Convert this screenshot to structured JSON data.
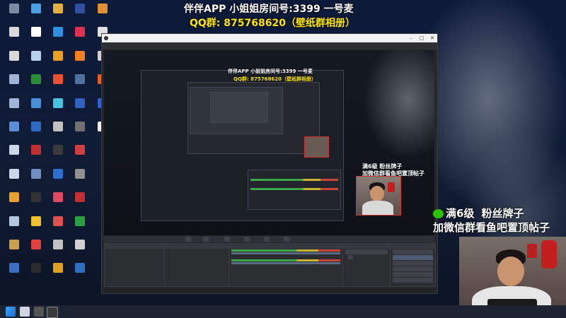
{
  "desktop": {
    "icons": [
      {
        "label": "",
        "color": "#7a8aa0"
      },
      {
        "label": "",
        "color": "#d9d9d9"
      },
      {
        "label": "",
        "color": "#d9d9d9"
      },
      {
        "label": "",
        "color": "#9fb4d8"
      },
      {
        "label": "",
        "color": "#9fb4d8"
      },
      {
        "label": "",
        "color": "#5a8fd8"
      },
      {
        "label": "",
        "color": "#c9d7e8"
      },
      {
        "label": "",
        "color": "#c9d7e8"
      },
      {
        "label": "",
        "color": "#e8a030"
      },
      {
        "label": "",
        "color": "#b5c7e0"
      },
      {
        "label": "",
        "color": "#c8a050"
      },
      {
        "label": "",
        "color": "#3c6fc4"
      },
      {
        "label": "",
        "color": "#4aa0e0"
      },
      {
        "label": "",
        "color": "#ffffff"
      },
      {
        "label": "",
        "color": "#b8d0ea"
      },
      {
        "label": "",
        "color": "#2e8b3a"
      },
      {
        "label": "",
        "color": "#4a8ed8"
      },
      {
        "label": "",
        "color": "#2b6bc0"
      },
      {
        "label": "",
        "color": "#c03030"
      },
      {
        "label": "",
        "color": "#6f90c0"
      },
      {
        "label": "",
        "color": "#333333"
      },
      {
        "label": "",
        "color": "#f0c030"
      },
      {
        "label": "",
        "color": "#e04040"
      },
      {
        "label": "",
        "color": "#2a2a2a"
      },
      {
        "label": "",
        "color": "#e0b040"
      },
      {
        "label": "",
        "color": "#2f8fe0"
      },
      {
        "label": "",
        "color": "#e8a020"
      },
      {
        "label": "",
        "color": "#e85030"
      },
      {
        "label": "",
        "color": "#4ac0e0"
      },
      {
        "label": "",
        "color": "#c0c0c0"
      },
      {
        "label": "",
        "color": "#3a3a3a"
      },
      {
        "label": "",
        "color": "#2d6fd0"
      },
      {
        "label": "",
        "color": "#e04a60"
      },
      {
        "label": "",
        "color": "#e05050"
      },
      {
        "label": "",
        "color": "#c0c0c0"
      },
      {
        "label": "",
        "color": "#e0a020"
      },
      {
        "label": "",
        "color": "#3050a0"
      },
      {
        "label": "",
        "color": "#e03050"
      },
      {
        "label": "",
        "color": "#f08020"
      },
      {
        "label": "",
        "color": "#5070a0"
      },
      {
        "label": "",
        "color": "#3060c0"
      },
      {
        "label": "",
        "color": "#707070"
      },
      {
        "label": "",
        "color": "#d04040"
      },
      {
        "label": "",
        "color": "#909090"
      },
      {
        "label": "",
        "color": "#c03030"
      },
      {
        "label": "",
        "color": "#2aa040"
      },
      {
        "label": "",
        "color": "#d0d0d0"
      },
      {
        "label": "",
        "color": "#3070c0"
      },
      {
        "label": "",
        "color": "#e09030"
      },
      {
        "label": "",
        "color": "#e0e0e0"
      },
      {
        "label": "",
        "color": "#d0d0d0"
      },
      {
        "label": "",
        "color": "#e06020"
      },
      {
        "label": "",
        "color": "#3060d0"
      },
      {
        "label": "",
        "color": "#f0f0f0"
      }
    ]
  },
  "banner": {
    "line1": "伴伴APP 小姐姐房间号:3399 一号麦",
    "line2": "QQ群: 875768620（壁纸群相册）"
  },
  "obs": {
    "title": "",
    "menu": [
      "",
      "",
      "",
      "",
      "",
      "",
      ""
    ],
    "preview_banner1": "伴伴APP 小姐姐房间号:3399 一号麦",
    "preview_banner2": "QQ群: 875768620（壁纸群相册）",
    "preview_watermark1": "满6级",
    "preview_watermark2": "粉丝牌子",
    "preview_watermark3": "加微信群看鱼吧置顶帖子",
    "scene_bar_label": "",
    "scene_bar_buttons": [
      "",
      "",
      "",
      "",
      "",
      ""
    ],
    "scene_bar_right": "",
    "docks": {
      "scenes": {
        "header": "",
        "items": [
          "",
          "",
          "",
          "",
          "",
          ""
        ]
      },
      "sources": {
        "header": "",
        "items": [
          "",
          "",
          "",
          "",
          "",
          "",
          "",
          "",
          "",
          "",
          "",
          "",
          ""
        ]
      },
      "mixer": {
        "header": "",
        "track1": "",
        "track2": "",
        "db1": "",
        "db2": ""
      },
      "transitions": {
        "header": "",
        "type": "",
        "duration_label": "",
        "duration": ""
      },
      "controls": {
        "header": "",
        "buttons": [
          "",
          "",
          "",
          "",
          "",
          "",
          ""
        ]
      }
    },
    "status": {
      "live": "",
      "rec": "",
      "cpu": "",
      "kbps": ""
    }
  },
  "overlay": {
    "line1_a": "满6级",
    "level_badge": "",
    "line1_b": "粉丝牌子",
    "line2": "加微信群看鱼吧置顶帖子"
  },
  "taskbar": {
    "clock": "",
    "date": ""
  }
}
